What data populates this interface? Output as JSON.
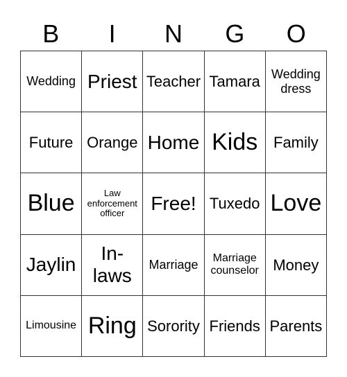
{
  "header": {
    "letters": [
      "B",
      "I",
      "N",
      "G",
      "O"
    ]
  },
  "board": {
    "rows": [
      [
        {
          "text": "Wedding",
          "size": "s-md"
        },
        {
          "text": "Priest",
          "size": "s-xl"
        },
        {
          "text": "Teacher",
          "size": "s-lg"
        },
        {
          "text": "Tamara",
          "size": "s-lg"
        },
        {
          "text": "Wedding dress",
          "size": "s-md"
        }
      ],
      [
        {
          "text": "Future",
          "size": "s-lg"
        },
        {
          "text": "Orange",
          "size": "s-lg"
        },
        {
          "text": "Home",
          "size": "s-xl"
        },
        {
          "text": "Kids",
          "size": "s-huge"
        },
        {
          "text": "Family",
          "size": "s-lg"
        }
      ],
      [
        {
          "text": "Blue",
          "size": "s-huge"
        },
        {
          "text": "Law enforcement officer",
          "size": "s-xs"
        },
        {
          "text": "Free!",
          "size": "s-xl"
        },
        {
          "text": "Tuxedo",
          "size": "s-lg"
        },
        {
          "text": "Love",
          "size": "s-huge"
        }
      ],
      [
        {
          "text": "Jaylin",
          "size": "s-xl"
        },
        {
          "text": "In-laws",
          "size": "s-xl"
        },
        {
          "text": "Marriage",
          "size": "s-md"
        },
        {
          "text": "Marriage counselor",
          "size": "s-sm"
        },
        {
          "text": "Money",
          "size": "s-lg"
        }
      ],
      [
        {
          "text": "Limousine",
          "size": "s-sm"
        },
        {
          "text": "Ring",
          "size": "s-huge"
        },
        {
          "text": "Sorority",
          "size": "s-lg"
        },
        {
          "text": "Friends",
          "size": "s-lg"
        },
        {
          "text": "Parents",
          "size": "s-lg"
        }
      ]
    ]
  }
}
